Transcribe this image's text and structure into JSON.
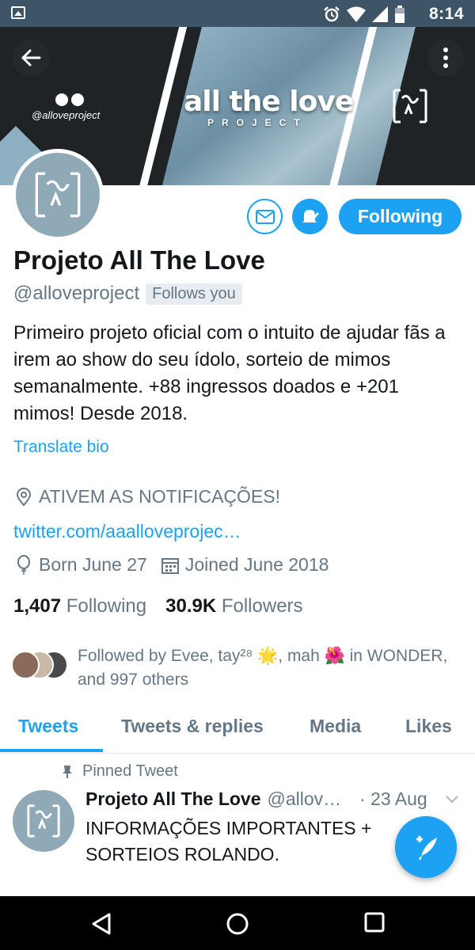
{
  "status_bar": {
    "time": "8:14"
  },
  "banner": {
    "title": "all the love",
    "subtitle": "PROJECT",
    "handle": "@alloveproject"
  },
  "profile": {
    "name": "Projeto All The Love",
    "handle": "@alloveproject",
    "follows_you": "Follows you",
    "bio": "Primeiro projeto oficial com o intuito de ajudar fãs a irem ao show do seu ídolo, sorteio de mimos semanalmente. +88 ingressos doados e +201 mimos! Desde 2018.",
    "translate_bio": "Translate bio",
    "location": "ATIVEM AS NOTIFICAÇÕES!",
    "website": "twitter.com/aaalloveprojec…",
    "born": "Born June 27",
    "joined": "Joined June 2018",
    "following_count": "1,407",
    "following_label": "Following",
    "followers_count": "30.9K",
    "followers_label": "Followers",
    "followed_by": "Followed by Evee, tay²⁸ 🌟, mah 🌺 in WONDER, and 997 others"
  },
  "actions": {
    "following_button": "Following"
  },
  "tabs": [
    {
      "label": "Tweets",
      "active": true
    },
    {
      "label": "Tweets & replies",
      "active": false
    },
    {
      "label": "Media",
      "active": false
    },
    {
      "label": "Likes",
      "active": false
    }
  ],
  "pinned_tweet": {
    "pinned_label": "Pinned Tweet",
    "name": "Projeto All The Love",
    "handle": "@allov…",
    "date": "· 23 Aug",
    "text": "INFORMAÇÕES IMPORTANTES + SORTEIOS ROLANDO."
  },
  "colors": {
    "accent": "#1da1f2",
    "secondary_text": "#657786",
    "status_bar": "#3e5568"
  }
}
